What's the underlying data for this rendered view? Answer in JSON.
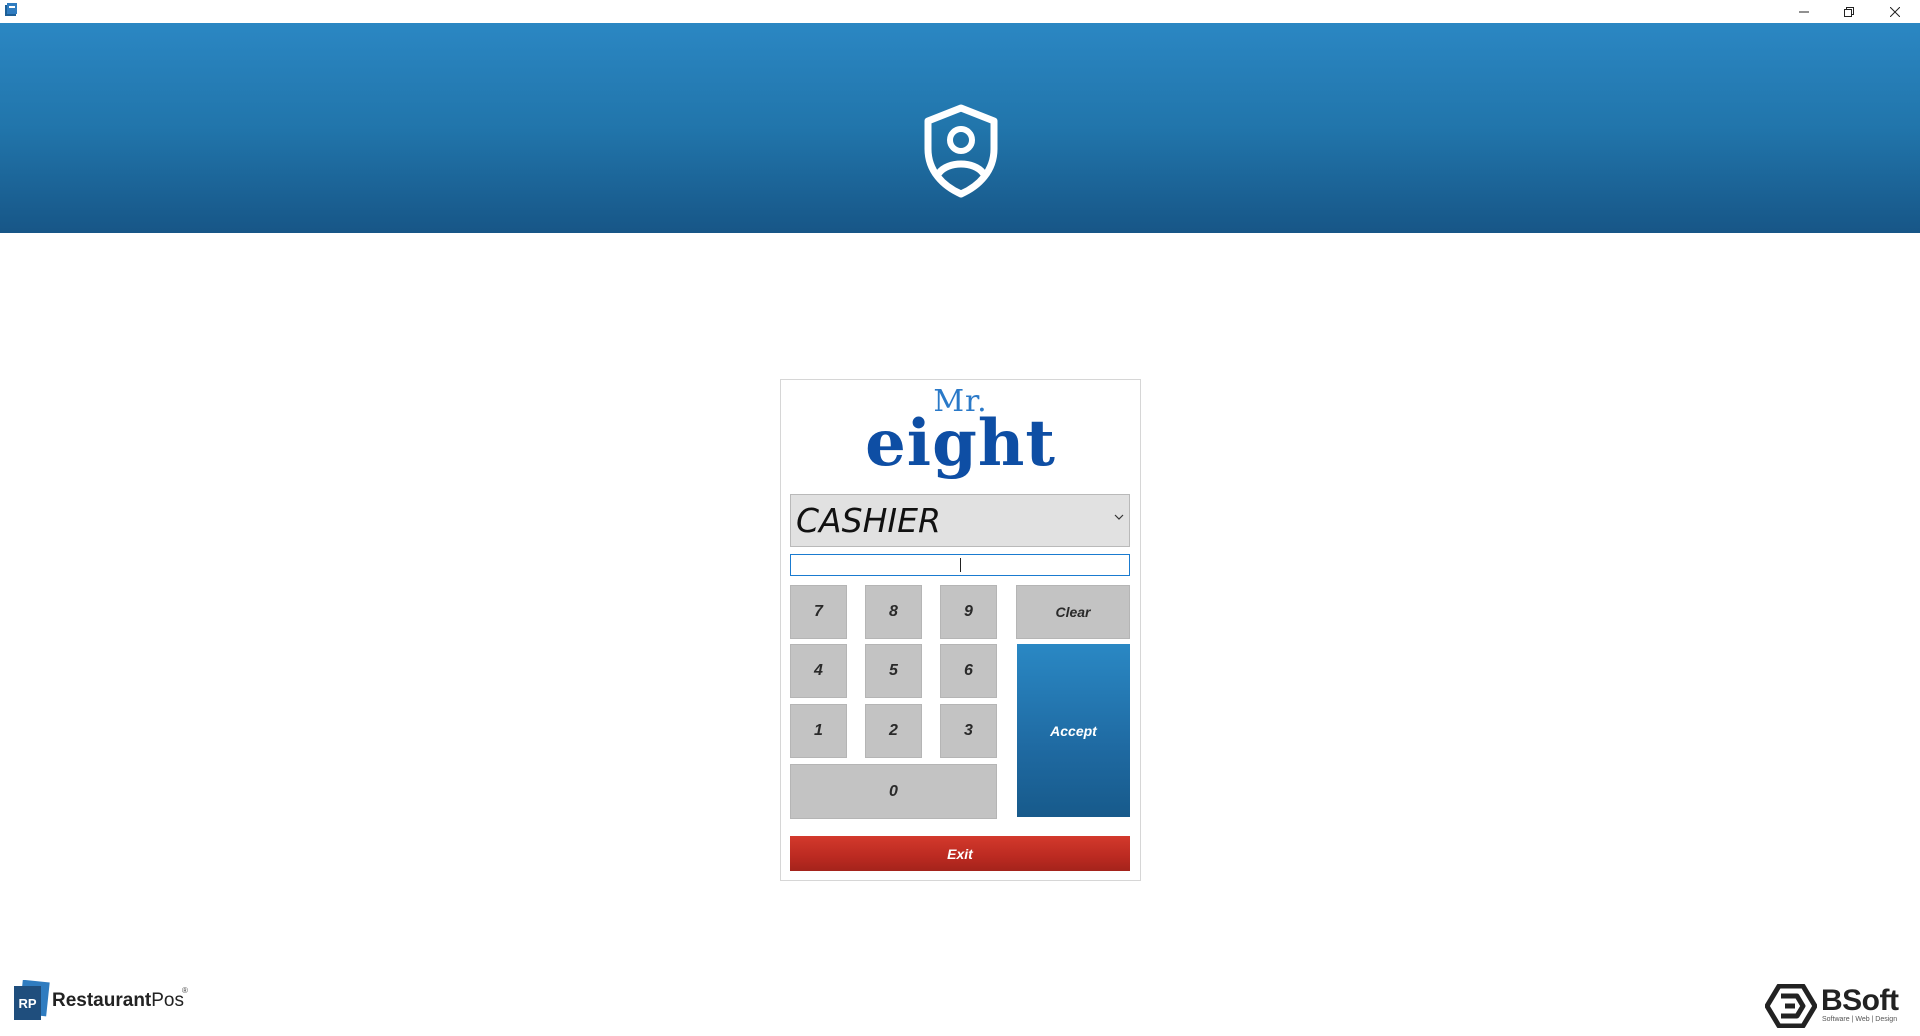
{
  "window": {
    "controls": {
      "minimize": "─",
      "maximize": "❐",
      "close": "✕"
    }
  },
  "header": {
    "icon": "user-shield-icon",
    "colors": {
      "top": "#2b87c3",
      "bottom": "#175687"
    }
  },
  "brand": {
    "line1": "Mr.",
    "line2": "eight"
  },
  "login": {
    "role_selected": "CASHIER",
    "pin_value": "",
    "keys": {
      "k7": "7",
      "k8": "8",
      "k9": "9",
      "clear": "Clear",
      "k4": "4",
      "k5": "5",
      "k6": "6",
      "k1": "1",
      "k2": "2",
      "k3": "3",
      "k0": "0",
      "accept": "Accept",
      "exit": "Exit"
    },
    "colors": {
      "accept": "#1f6aa2",
      "exit": "#bb2a21",
      "key": "#c3c3c3"
    }
  },
  "footer": {
    "left_logo": {
      "badge": "RP",
      "name_bold": "Restaurant",
      "name_regular": "Pos",
      "reg": "®"
    },
    "right_logo": {
      "name": "BSoft",
      "tagline": "Software | Web | Design"
    }
  }
}
